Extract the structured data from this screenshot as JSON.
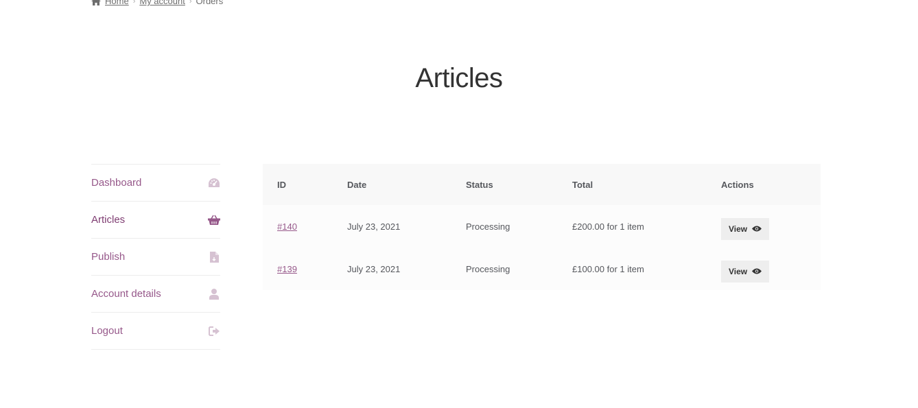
{
  "breadcrumb": {
    "home": "Home",
    "my_account": "My account",
    "current": "Orders",
    "separator": "›"
  },
  "page": {
    "title": "Articles"
  },
  "nav": {
    "items": [
      {
        "label": "Dashboard",
        "icon": "dashboard-icon"
      },
      {
        "label": "Articles",
        "icon": "basket-icon",
        "active": true
      },
      {
        "label": "Publish",
        "icon": "file-icon"
      },
      {
        "label": "Account details",
        "icon": "user-icon"
      },
      {
        "label": "Logout",
        "icon": "sign-out-icon"
      }
    ]
  },
  "table": {
    "headers": [
      "ID",
      "Date",
      "Status",
      "Total",
      "Actions"
    ],
    "rows": [
      {
        "id": "#140",
        "date": "July 23, 2021",
        "status": "Processing",
        "total": "£200.00 for 1 item",
        "action": "View"
      },
      {
        "id": "#139",
        "date": "July 23, 2021",
        "status": "Processing",
        "total": "£100.00 for 1 item",
        "action": "View"
      }
    ]
  },
  "colors": {
    "accent": "#96588a",
    "icon_muted": "#d6c2d2",
    "icon_active": "#96588a",
    "header_bg": "#f8f8f8",
    "row_bg": "#fcfcfc",
    "button_bg": "#eeeeee"
  }
}
